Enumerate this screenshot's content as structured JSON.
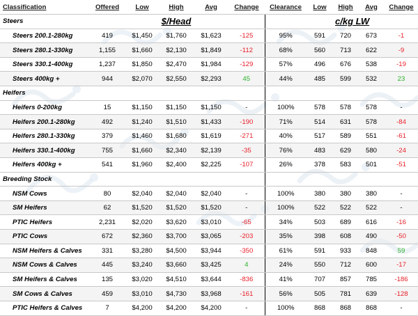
{
  "headers": {
    "classification": "Classification",
    "offered": "Offered",
    "low": "Low",
    "high": "High",
    "avg": "Avg",
    "change": "Change",
    "clearance": "Clearance",
    "low2": "Low",
    "high2": "High",
    "avg2": "Avg",
    "change2": "Change"
  },
  "units": {
    "head": "$/Head",
    "lw": "c/kg LW"
  },
  "sections": [
    {
      "title": "Steers",
      "rows": [
        {
          "label": "Steers 200.1-280kg",
          "offered": "419",
          "low": "$1,450",
          "high": "$1,760",
          "avg": "$1,623",
          "change": "-125",
          "change_color": "red",
          "clearance": "95%",
          "low2": "591",
          "high2": "720",
          "avg2": "673",
          "change2": "-1",
          "change2_color": "red"
        },
        {
          "label": "Steers 280.1-330kg",
          "offered": "1,155",
          "low": "$1,660",
          "high": "$2,130",
          "avg": "$1,849",
          "change": "-112",
          "change_color": "red",
          "clearance": "68%",
          "low2": "560",
          "high2": "713",
          "avg2": "622",
          "change2": "-9",
          "change2_color": "red"
        },
        {
          "label": "Steers 330.1-400kg",
          "offered": "1,237",
          "low": "$1,850",
          "high": "$2,470",
          "avg": "$1,984",
          "change": "-129",
          "change_color": "red",
          "clearance": "57%",
          "low2": "496",
          "high2": "676",
          "avg2": "538",
          "change2": "-19",
          "change2_color": "red"
        },
        {
          "label": "Steers 400kg +",
          "offered": "944",
          "low": "$2,070",
          "high": "$2,550",
          "avg": "$2,293",
          "change": "45",
          "change_color": "green",
          "clearance": "44%",
          "low2": "485",
          "high2": "599",
          "avg2": "532",
          "change2": "23",
          "change2_color": "green"
        }
      ]
    },
    {
      "title": "Heifers",
      "rows": [
        {
          "label": "Heifers 0-200kg",
          "offered": "15",
          "low": "$1,150",
          "high": "$1,150",
          "avg": "$1,150",
          "change": "-",
          "change_color": "black",
          "clearance": "100%",
          "low2": "578",
          "high2": "578",
          "avg2": "578",
          "change2": "-",
          "change2_color": "black"
        },
        {
          "label": "Heifers 200.1-280kg",
          "offered": "492",
          "low": "$1,240",
          "high": "$1,510",
          "avg": "$1,433",
          "change": "-190",
          "change_color": "red",
          "clearance": "71%",
          "low2": "514",
          "high2": "631",
          "avg2": "578",
          "change2": "-84",
          "change2_color": "red"
        },
        {
          "label": "Heifers 280.1-330kg",
          "offered": "379",
          "low": "$1,460",
          "high": "$1,680",
          "avg": "$1,619",
          "change": "-271",
          "change_color": "red",
          "clearance": "40%",
          "low2": "517",
          "high2": "589",
          "avg2": "551",
          "change2": "-61",
          "change2_color": "red"
        },
        {
          "label": "Heifers 330.1-400kg",
          "offered": "755",
          "low": "$1,660",
          "high": "$2,340",
          "avg": "$2,139",
          "change": "-35",
          "change_color": "red",
          "clearance": "76%",
          "low2": "483",
          "high2": "629",
          "avg2": "580",
          "change2": "-24",
          "change2_color": "red"
        },
        {
          "label": "Heifers 400kg +",
          "offered": "541",
          "low": "$1,960",
          "high": "$2,400",
          "avg": "$2,225",
          "change": "-107",
          "change_color": "red",
          "clearance": "26%",
          "low2": "378",
          "high2": "583",
          "avg2": "501",
          "change2": "-51",
          "change2_color": "red"
        }
      ]
    },
    {
      "title": "Breeding Stock",
      "rows": [
        {
          "label": "NSM Cows",
          "offered": "80",
          "low": "$2,040",
          "high": "$2,040",
          "avg": "$2,040",
          "change": "-",
          "change_color": "black",
          "clearance": "100%",
          "low2": "380",
          "high2": "380",
          "avg2": "380",
          "change2": "-",
          "change2_color": "black"
        },
        {
          "label": "SM Heifers",
          "offered": "62",
          "low": "$1,520",
          "high": "$1,520",
          "avg": "$1,520",
          "change": "-",
          "change_color": "black",
          "clearance": "100%",
          "low2": "522",
          "high2": "522",
          "avg2": "522",
          "change2": "-",
          "change2_color": "black"
        },
        {
          "label": "PTIC Heifers",
          "offered": "2,231",
          "low": "$2,020",
          "high": "$3,620",
          "avg": "$3,010",
          "change": "-65",
          "change_color": "red",
          "clearance": "34%",
          "low2": "503",
          "high2": "689",
          "avg2": "616",
          "change2": "-16",
          "change2_color": "red"
        },
        {
          "label": "PTIC Cows",
          "offered": "672",
          "low": "$2,360",
          "high": "$3,700",
          "avg": "$3,065",
          "change": "-203",
          "change_color": "red",
          "clearance": "35%",
          "low2": "398",
          "high2": "608",
          "avg2": "490",
          "change2": "-50",
          "change2_color": "red"
        },
        {
          "label": "NSM Heifers & Calves",
          "offered": "331",
          "low": "$3,280",
          "high": "$4,500",
          "avg": "$3,944",
          "change": "-350",
          "change_color": "red",
          "clearance": "61%",
          "low2": "591",
          "high2": "933",
          "avg2": "848",
          "change2": "59",
          "change2_color": "green"
        },
        {
          "label": "NSM Cows & Calves",
          "offered": "445",
          "low": "$3,240",
          "high": "$3,660",
          "avg": "$3,425",
          "change": "4",
          "change_color": "green",
          "clearance": "24%",
          "low2": "550",
          "high2": "712",
          "avg2": "600",
          "change2": "-17",
          "change2_color": "red"
        },
        {
          "label": "SM Heifers & Calves",
          "offered": "135",
          "low": "$3,020",
          "high": "$4,510",
          "avg": "$3,644",
          "change": "-836",
          "change_color": "red",
          "clearance": "41%",
          "low2": "707",
          "high2": "857",
          "avg2": "785",
          "change2": "-186",
          "change2_color": "red"
        },
        {
          "label": "SM Cows & Calves",
          "offered": "459",
          "low": "$3,010",
          "high": "$4,730",
          "avg": "$3,968",
          "change": "-161",
          "change_color": "red",
          "clearance": "56%",
          "low2": "505",
          "high2": "781",
          "avg2": "639",
          "change2": "-128",
          "change2_color": "red"
        },
        {
          "label": "PTIC Heifers & Calves",
          "offered": "7",
          "low": "$4,200",
          "high": "$4,200",
          "avg": "$4,200",
          "change": "-",
          "change_color": "black",
          "clearance": "100%",
          "low2": "868",
          "high2": "868",
          "avg2": "868",
          "change2": "-",
          "change2_color": "black"
        }
      ]
    }
  ]
}
